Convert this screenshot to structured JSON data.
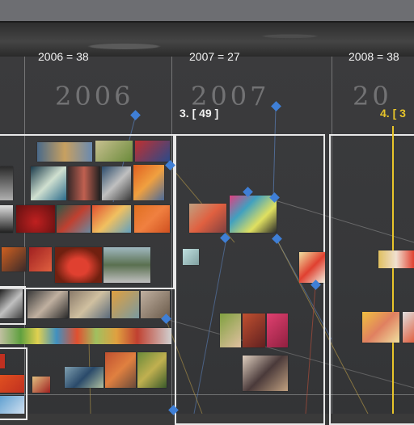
{
  "timeline": {
    "years": [
      {
        "header": "2006 = 38",
        "chalk": "2006"
      },
      {
        "header": "2007 = 27",
        "chalk": "2007",
        "count_label": "3. [ 49 ]"
      },
      {
        "header": "2008  = 38",
        "chalk": "20",
        "count_label": "4. [ 3"
      }
    ]
  },
  "colors": {
    "board": "#3a3a3a",
    "header_text": "#f2f2f2",
    "highlight": "#e8c52a",
    "node": "#3f7fd6",
    "frame": "#e8e8e8"
  }
}
